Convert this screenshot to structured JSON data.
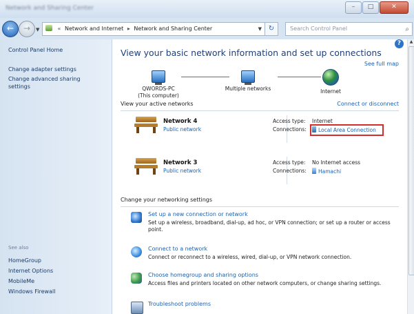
{
  "window": {
    "title": "Network and Sharing Center",
    "buttons": {
      "minimize": "–",
      "maximize": "□",
      "close": "✕"
    }
  },
  "address_bar": {
    "back_icon": "←",
    "forward_icon": "→",
    "breadcrumb": [
      "Network and Internet",
      "Network and Sharing Center"
    ],
    "prefix": "«",
    "search_placeholder": "Search Control Panel"
  },
  "sidebar": {
    "items": [
      {
        "label": "Control Panel Home"
      },
      {
        "label": "Change adapter settings"
      },
      {
        "label": "Change advanced sharing settings"
      }
    ],
    "see_also_title": "See also",
    "see_also": [
      {
        "label": "HomeGroup"
      },
      {
        "label": "Internet Options"
      },
      {
        "label": "MobileMe"
      },
      {
        "label": "Windows Firewall"
      }
    ]
  },
  "main": {
    "heading": "View your basic network information and set up connections",
    "see_full_map": "See full map",
    "network_map": {
      "computer_name": "QWORDS-PC",
      "computer_sub": "(This computer)",
      "middle": "Multiple networks",
      "internet": "Internet"
    },
    "active_networks_label": "View your active networks",
    "connect_disconnect": "Connect or disconnect",
    "networks": [
      {
        "name": "Network 4",
        "type": "Public network",
        "access_label": "Access type:",
        "access_value": "Internet",
        "connections_label": "Connections:",
        "connection": "Local Area Connection"
      },
      {
        "name": "Network 3",
        "type": "Public network",
        "access_label": "Access type:",
        "access_value": "No Internet access",
        "connections_label": "Connections:",
        "connection": "Hamachi"
      }
    ],
    "change_settings_label": "Change your networking settings",
    "tasks": [
      {
        "title": "Set up a new connection or network",
        "desc": "Set up a wireless, broadband, dial-up, ad hoc, or VPN connection; or set up a router or access point.",
        "icon": "network-setup-icon"
      },
      {
        "title": "Connect to a network",
        "desc": "Connect or reconnect to a wireless, wired, dial-up, or VPN network connection.",
        "icon": "connect-network-icon"
      },
      {
        "title": "Choose homegroup and sharing options",
        "desc": "Access files and printers located on other network computers, or change sharing settings.",
        "icon": "homegroup-icon"
      },
      {
        "title": "Troubleshoot problems",
        "desc": "",
        "icon": "troubleshoot-icon"
      }
    ]
  },
  "colors": {
    "link": "#1960b0",
    "highlight_box": "#d42b2b",
    "sidebar_bg": "#d5e3f1"
  }
}
